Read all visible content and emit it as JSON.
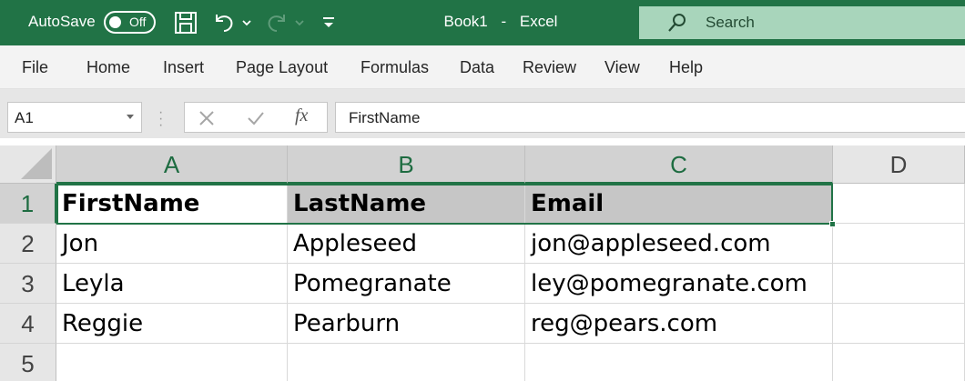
{
  "titlebar": {
    "autosave_label": "AutoSave",
    "autosave_state": "Off",
    "title": "Book1",
    "separator": "-",
    "app": "Excel",
    "search_placeholder": "Search",
    "accent_color": "#217346",
    "icons": [
      "save-icon",
      "undo-icon",
      "undo-dropdown-icon",
      "redo-icon",
      "redo-dropdown-icon",
      "customize-toolbar-icon",
      "search-icon"
    ]
  },
  "ribbon": {
    "tabs": [
      {
        "label": "File"
      },
      {
        "label": "Home"
      },
      {
        "label": "Insert"
      },
      {
        "label": "Page Layout"
      },
      {
        "label": "Formulas"
      },
      {
        "label": "Data"
      },
      {
        "label": "Review"
      },
      {
        "label": "View"
      },
      {
        "label": "Help"
      }
    ]
  },
  "formula_bar": {
    "name_box": "A1",
    "fx_label": "fx",
    "formula": "FirstName",
    "icons": [
      "cancel-icon",
      "enter-icon",
      "insert-function-icon"
    ]
  },
  "grid": {
    "columns": [
      "A",
      "B",
      "C",
      "D"
    ],
    "rows": [
      "1",
      "2",
      "3",
      "4",
      "5"
    ],
    "selected_range": "A1:C1",
    "cells": [
      [
        "FirstName",
        "LastName",
        "Email",
        ""
      ],
      [
        "Jon",
        "Appleseed",
        "jon@appleseed.com",
        ""
      ],
      [
        "Leyla",
        "Pomegranate",
        "ley@pomegranate.com",
        ""
      ],
      [
        "Reggie",
        "Pearburn",
        "reg@pears.com",
        ""
      ],
      [
        "",
        "",
        "",
        ""
      ]
    ]
  }
}
